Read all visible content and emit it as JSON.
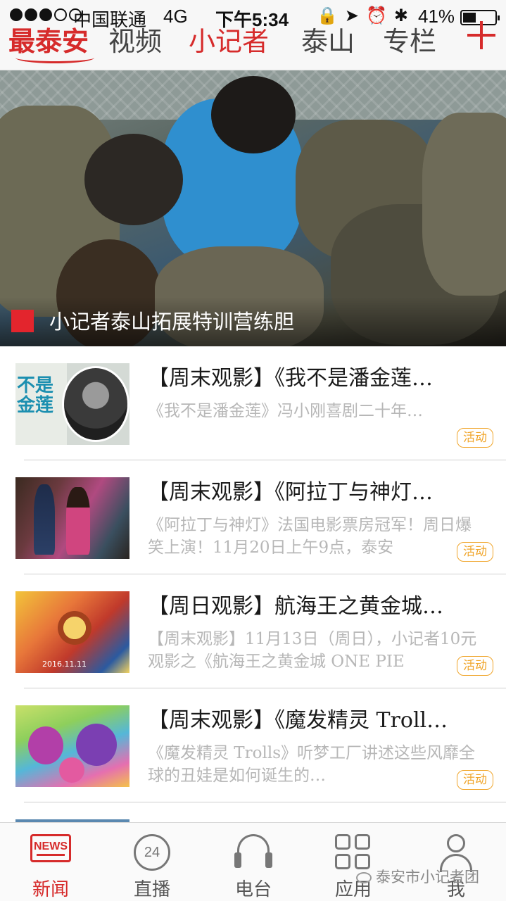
{
  "status_bar": {
    "carrier": "中国联通",
    "network": "4G",
    "time": "下午5:34",
    "battery_percent": "41%",
    "battery_level": 0.41
  },
  "nav": {
    "logo": "最泰安",
    "tabs": [
      {
        "label": "视频"
      },
      {
        "label": "小记者",
        "active": true
      },
      {
        "label": "泰山"
      },
      {
        "label": "专栏"
      }
    ],
    "accent_color": "#d62b2b"
  },
  "hero": {
    "caption": "小记者泰山拓展特训营练胆"
  },
  "news": [
    {
      "title": "【周末观影】《我不是潘金莲…",
      "summary": "《我不是潘金莲》冯小刚喜剧二十年…",
      "badge": "活动",
      "thumb_text": "不是\n金莲"
    },
    {
      "title": "【周末观影】《阿拉丁与神灯…",
      "summary": "《阿拉丁与神灯》法国电影票房冠军！周日爆笑上演！11月20日上午9点，泰安",
      "badge": "活动"
    },
    {
      "title": "【周日观影】航海王之黄金城…",
      "summary": "【周末观影】11月13日（周日），小记者10元观影之《航海王之黄金城 ONE PIE",
      "badge": "活动",
      "thumb_text": "2016.11.11"
    },
    {
      "title": "【周末观影】《魔发精灵 Troll…",
      "summary": "《魔发精灵 Trolls》听梦工厂讲述这些风靡全球的丑娃是如何诞生的…",
      "badge": "活动"
    }
  ],
  "tabbar": {
    "tabs": [
      {
        "label": "新闻",
        "icon": "news-icon",
        "icon_text": "NEWS",
        "active": true
      },
      {
        "label": "直播",
        "icon": "live-icon",
        "icon_text": "24"
      },
      {
        "label": "电台",
        "icon": "headphones-icon"
      },
      {
        "label": "应用",
        "icon": "apps-grid-icon"
      },
      {
        "label": "我",
        "icon": "profile-icon"
      }
    ]
  },
  "watermark": "泰安市小记者团"
}
